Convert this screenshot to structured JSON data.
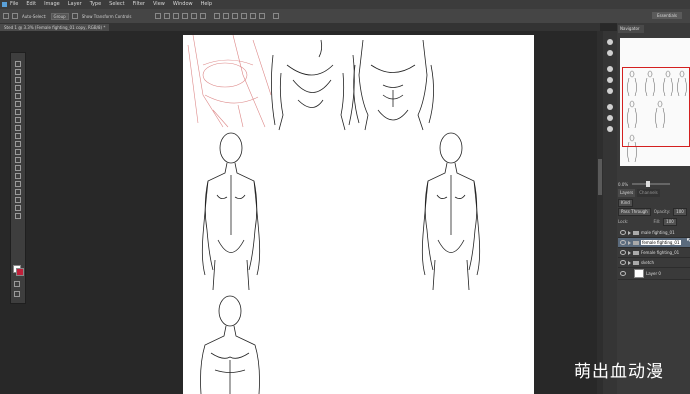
{
  "menu": [
    "File",
    "Edit",
    "Image",
    "Layer",
    "Type",
    "Select",
    "Filter",
    "View",
    "Window",
    "Help"
  ],
  "options": {
    "auto_select": "Auto-Select:",
    "group": "Group",
    "show_transform": "Show Transform Controls"
  },
  "workspace": "Essentials",
  "doc_tab": "Sted 1 @ 3.3% (Female fighting_01 copy, RGB/8) *",
  "navigator_tab": "Navigator",
  "zoom": "0.0%",
  "layers_tabs": [
    "Layers",
    "Channels"
  ],
  "layers_controls": {
    "kind": "Kind",
    "blend": "Pass Through",
    "opacity_label": "Opacity:",
    "opacity": "100",
    "lock_label": "Lock:",
    "fill_label": "Fill:",
    "fill": "100"
  },
  "layers": [
    {
      "name": "male fighting_01",
      "selected": false,
      "type": "folder"
    },
    {
      "name": "female fighting_01",
      "selected": true,
      "type": "folder"
    },
    {
      "name": "Female fighting_01",
      "selected": false,
      "type": "folder"
    },
    {
      "name": "sketch",
      "selected": false,
      "type": "folder"
    },
    {
      "name": "Layer 0",
      "selected": false,
      "type": "layer"
    }
  ],
  "watermark": "萌出血动漫",
  "colors": {
    "accent": "#d42020",
    "fg_swatch": "#ffffff",
    "bg_swatch": "#c0203a",
    "selected_layer": "#5b6b7d"
  }
}
